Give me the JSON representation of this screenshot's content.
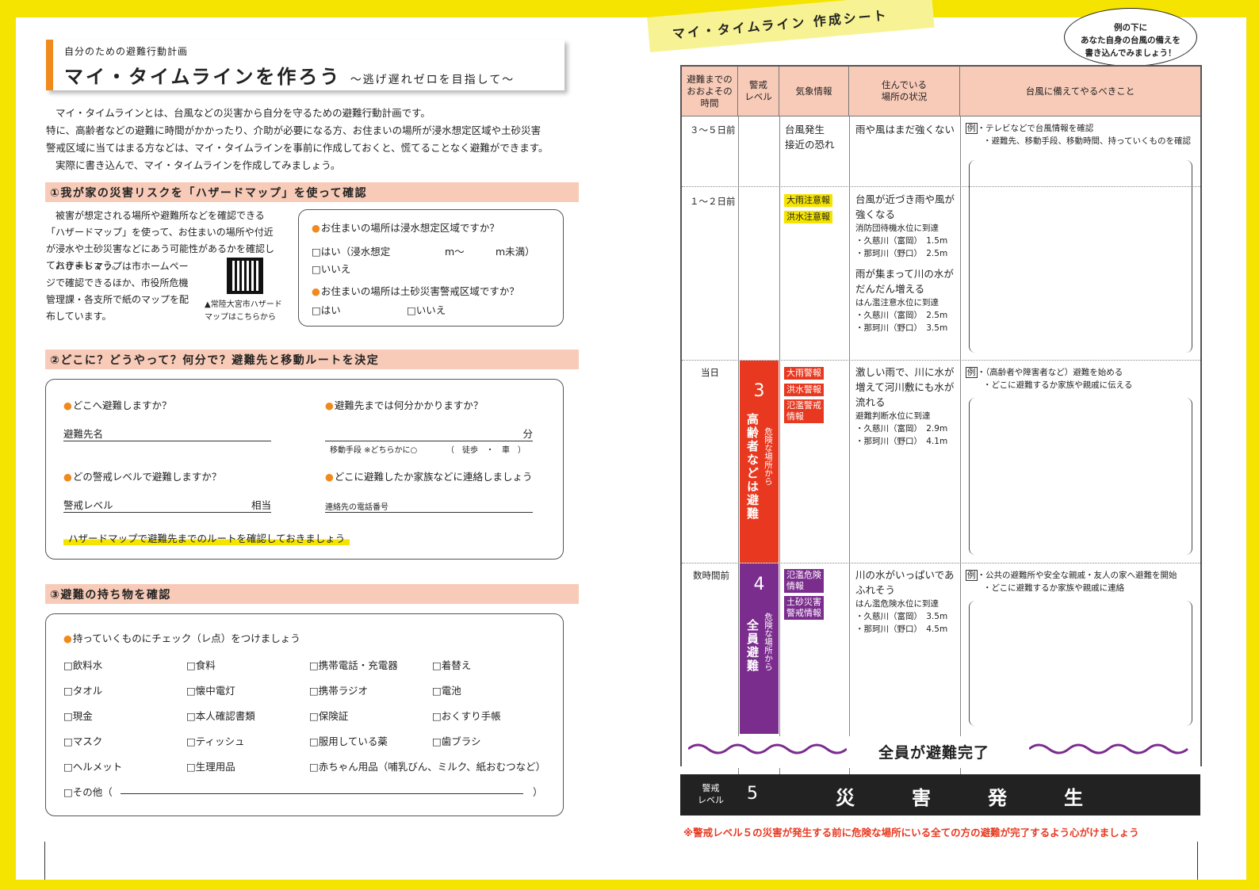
{
  "left": {
    "subtitle": "自分のための避難行動計画",
    "title": "マイ・タイムラインを作ろう",
    "title_tail": "〜逃げ遅れゼロを目指して〜",
    "intro_lines": [
      "マイ・タイムラインとは、台風などの災害から自分を守るための避難行動計画です。",
      "特に、高齢者などの避難に時間がかかったり、介助が必要になる方、お住まいの場所が浸水想定区域や土砂災害",
      "警戒区域に当てはまる方などは、マイ・タイムラインを事前に作成しておくと、慌てることなく避難ができます。",
      "実際に書き込んで、マイ・タイムラインを作成してみましょう。"
    ],
    "s1": {
      "heading": "①我が家の災害リスクを「ハザードマップ」を使って確認",
      "text1": "被害が想定される場所や避難所などを確認できる「ハザードマップ」を使って、お住まいの場所や付近が浸水や土砂災害などにあう可能性があるかを確認しておきましょう。",
      "text2": "ハザードマップは市ホームページで確認できるほか、市役所危機管理課・各支所で紙のマップを配布しています。",
      "qr_caption": "▲常陸大宮市ハザードマップはこちらから",
      "q1": "お住まいの場所は浸水想定区域ですか？",
      "q1_yes": "□はい（浸水想定",
      "q1_m1": "m〜",
      "q1_m2": "m未満）",
      "q1_no": "□いいえ",
      "q2": "お住まいの場所は土砂災害警戒区域ですか？",
      "q2_yes": "□はい",
      "q2_no": "□いいえ"
    },
    "s2": {
      "heading": "②どこに？どうやって？何分で？避難先と移動ルートを決定",
      "q1": "どこへ避難しますか？",
      "q1_field": "避難先名",
      "q2": "避難先までは何分かかりますか？",
      "q2_unit": "分",
      "q2_note": "移動手段 ※どちらかに○",
      "q2_opts": "（　徒歩　・　車　）",
      "q3": "どの警戒レベルで避難しますか？",
      "q3_field": "警戒レベル",
      "q3_unit": "相当",
      "q4": "どこに避難したか家族などに連絡しましょう",
      "q4_field": "連絡先の電話番号",
      "note": "ハザードマップで避難先までのルートを確認しておきましょう"
    },
    "s3": {
      "heading": "③避難の持ち物を確認",
      "lead": "持っていくものにチェック（レ点）をつけましょう",
      "rows": [
        [
          "□飲料水",
          "□食料",
          "□携帯電話・充電器",
          "□着替え"
        ],
        [
          "□タオル",
          "□懐中電灯",
          "□携帯ラジオ",
          "□電池"
        ],
        [
          "□現金",
          "□本人確認書類",
          "□保険証",
          "□おくすり手帳"
        ],
        [
          "□マスク",
          "□ティッシュ",
          "□服用している薬",
          "□歯ブラシ"
        ],
        [
          "□ヘルメット",
          "□生理用品",
          "□赤ちゃん用品（哺乳びん、ミルク、紙おむつなど）",
          ""
        ]
      ],
      "other": "□その他（",
      "other_end": "）"
    }
  },
  "right": {
    "tape": "マイ・タイムライン 作成シート",
    "bubble": [
      "例の下に",
      "あなた自身の台風の備えを",
      "書き込んでみましょう！"
    ],
    "headers": [
      "避難までの\nおおよその\n時間",
      "警戒\nレベル",
      "気象情報",
      "住んでいる\n場所の状況",
      "台風に備えてやるべきこと"
    ],
    "r1": {
      "time": "３〜５日前",
      "wx": "台風発生\n接近の恐れ",
      "sit": "雨や風はまだ強くない",
      "ex1": "・テレビなどで台風情報を確認",
      "ex2": "・避難先、移動手段、移動時間、持っていくものを確認"
    },
    "r2": {
      "time": "１〜２日前",
      "tag1": "大雨注意報",
      "tag2": "洪水注意報",
      "sit1": "台風が近づき雨や風が強くなる",
      "sub1": "消防団待機水位に到達",
      "riv1a": "・久慈川（富岡）　1.5m",
      "riv1b": "・那珂川（野口）　2.5m",
      "sit2": "雨が集まって川の水がだんだん増える",
      "sub2": "はん濫注意水位に到達",
      "riv2a": "・久慈川（富岡）　2.5m",
      "riv2b": "・那珂川（野口）　3.5m"
    },
    "r3": {
      "time": "当日",
      "lvl": "3",
      "lvl_text": "高齢者などは避難",
      "lvl_small": "危険な場所から",
      "tag1": "大雨警報",
      "tag2": "洪水警報",
      "tag3": "氾濫警戒\n情報",
      "sit": "激しい雨で、川に水が増えて河川敷にも水が流れる",
      "sub": "避難判断水位に到達",
      "riva": "・久慈川（富岡）　2.9m",
      "rivb": "・那珂川（野口）　4.1m",
      "ex1": "・（高齢者や障害者など）避難を始める",
      "ex2": "・どこに避難するか家族や親戚に伝える"
    },
    "r4": {
      "time": "数時間前",
      "lvl": "4",
      "lvl_text": "全員避難",
      "lvl_small": "危険な場所から",
      "tag1": "氾濫危険\n情報",
      "tag2": "土砂災害\n警戒情報",
      "sit": "川の水がいっぱいであふれそう",
      "sub": "はん濫危険水位に到達",
      "riva": "・久慈川（富岡）　3.5m",
      "rivb": "・那珂川（野口）　4.5m",
      "ex1": "・公共の避難所や安全な親戚・友人の家へ避難を開始",
      "ex2": "・どこに避難するか家族や親戚に連絡"
    },
    "rei": "例",
    "done": "全員が避難完了",
    "bar_label": "警戒\nレベル",
    "bar_lvl": "5",
    "bar_chars": [
      "災",
      "害",
      "発",
      "生"
    ],
    "footnote": "※警戒レベル５の災害が発生する前に危険な場所にいる全ての方の避難が完了するよう心がけましょう"
  },
  "colors": {
    "frame": "#f5e400",
    "orange": "#ef8a1f",
    "salmon": "#f8cbb8",
    "red": "#e8381f",
    "purple": "#7b2d8e"
  }
}
